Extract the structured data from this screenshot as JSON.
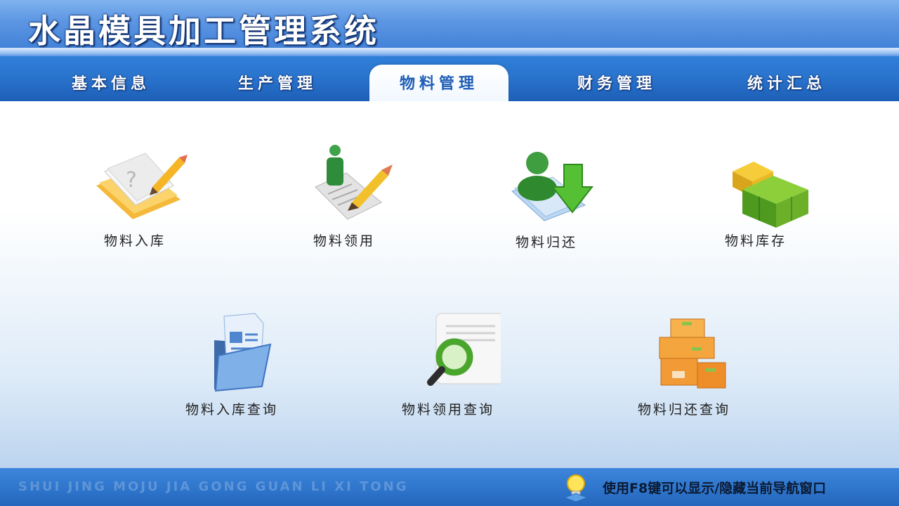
{
  "app": {
    "title": "水晶模具加工管理系统"
  },
  "nav": {
    "tabs": [
      {
        "label": "基本信息",
        "active": false
      },
      {
        "label": "生产管理",
        "active": false
      },
      {
        "label": "物料管理",
        "active": true
      },
      {
        "label": "财务管理",
        "active": false
      },
      {
        "label": "统计汇总",
        "active": false
      }
    ]
  },
  "main": {
    "tiles": [
      {
        "label": "物料入库",
        "icon": "notebook-pencil-icon"
      },
      {
        "label": "物料领用",
        "icon": "person-document-pencil-icon"
      },
      {
        "label": "物料归还",
        "icon": "user-down-arrow-icon"
      },
      {
        "label": "物料库存",
        "icon": "green-cubes-icon"
      },
      {
        "label": "物料入库查询",
        "icon": "folder-documents-icon"
      },
      {
        "label": "物料领用查询",
        "icon": "document-magnifier-icon"
      },
      {
        "label": "物料归还查询",
        "icon": "stacked-boxes-icon"
      }
    ]
  },
  "footer": {
    "slogan": "SHUI JING MOJU JIA GONG GUAN LI XI TONG",
    "hint": "使用F8键可以显示/隐藏当前导航窗口",
    "hint_icon": "lightbulb-icon"
  },
  "colors": {
    "header_blue": "#3f7fd6",
    "nav_blue": "#2a74cd",
    "active_tab_text": "#1f5eb5",
    "footer_blue": "#2d74ca"
  }
}
